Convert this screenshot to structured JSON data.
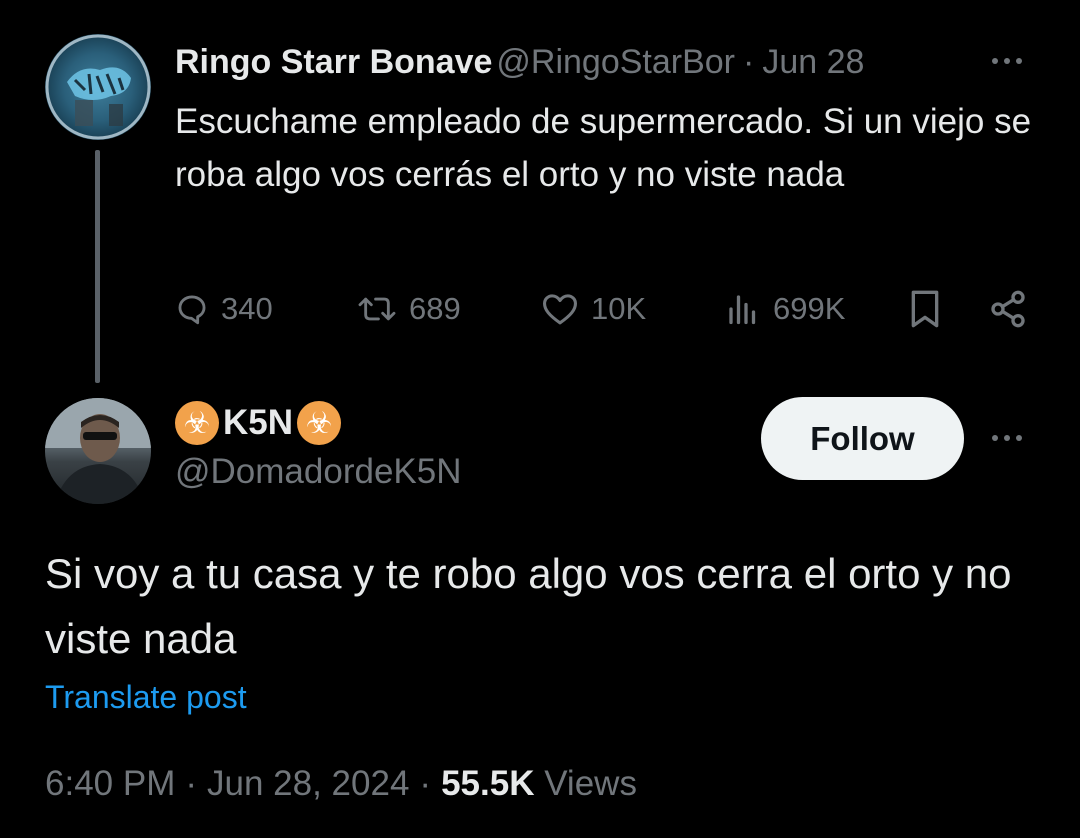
{
  "parent": {
    "name": "Ringo Starr Bonave",
    "handle": "@RingoStarBor",
    "separator": "·",
    "date": "Jun 28",
    "text": "Escuchame empleado de supermercado. Si un viejo se roba algo vos cerrás el orto y no viste nada",
    "stats": {
      "replies": "340",
      "retweets": "689",
      "likes": "10K",
      "views": "699K"
    }
  },
  "reply": {
    "name": "K5N",
    "name_badge": "☣",
    "handle": "@DomadordeK5N",
    "follow_label": "Follow",
    "text": "Si voy a tu casa y te robo algo vos cerra el orto y no viste nada",
    "translate_label": "Translate post",
    "time": "6:40 PM",
    "separator": "·",
    "date": "Jun 28, 2024",
    "views_count": "55.5K",
    "views_label": "Views"
  },
  "icons": {
    "more": "more-horizontal-icon",
    "reply": "reply-icon",
    "retweet": "retweet-icon",
    "like": "heart-icon",
    "views": "views-chart-icon",
    "bookmark": "bookmark-icon",
    "share": "share-icon"
  },
  "colors": {
    "background": "#000000",
    "primary_text": "#e7e9ea",
    "secondary_text": "#71767b",
    "link": "#1d9bf0",
    "follow_button_bg": "#eff3f4",
    "hazard_badge": "#f2a24b"
  }
}
